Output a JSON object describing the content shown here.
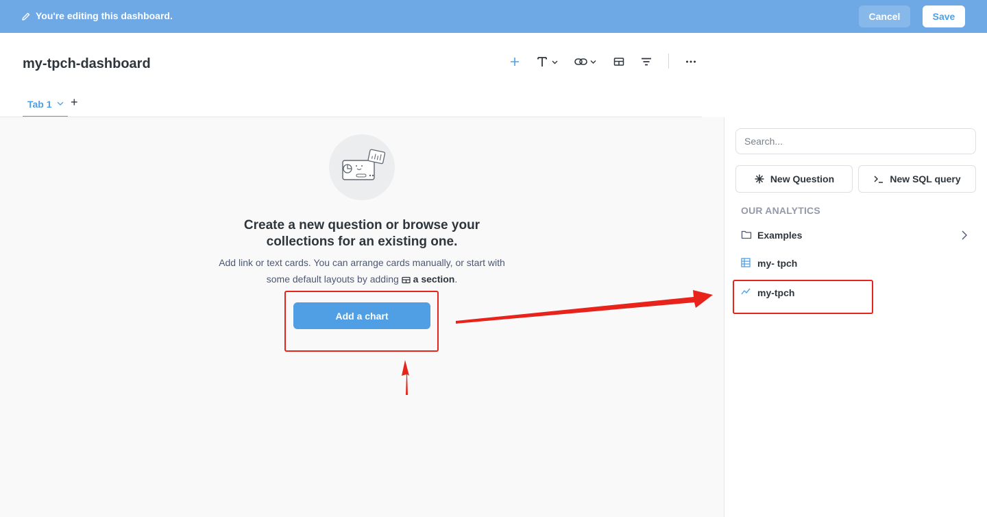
{
  "editbar": {
    "message": "You're editing this dashboard.",
    "cancel_label": "Cancel",
    "save_label": "Save"
  },
  "header": {
    "title": "my-tpch-dashboard",
    "toolbar_icons": [
      "add-card-icon",
      "text-card-icon",
      "link-card-icon",
      "section-icon",
      "filter-icon",
      "more-icon"
    ]
  },
  "tabs": {
    "items": [
      {
        "label": "Tab 1"
      }
    ],
    "add_label": "+"
  },
  "empty_state": {
    "title": "Create a new question or browse your collections for an existing one.",
    "desc_before": "Add link or text cards. You can arrange cards manually, or start with some default layouts by adding",
    "desc_link": "a section",
    "desc_after": ".",
    "button_label": "Add a chart"
  },
  "sidebar": {
    "search_placeholder": "Search...",
    "new_question_label": "New Question",
    "new_sql_label": "New SQL query",
    "section_title": "OUR ANALYTICS",
    "items": [
      {
        "label": "Examples",
        "icon": "folder-icon"
      },
      {
        "label": "my- tpch",
        "icon": "table-icon"
      },
      {
        "label": "my-tpch",
        "icon": "line-chart-icon"
      }
    ]
  },
  "colors": {
    "editbar": "#6ea9e6",
    "brand": "#509ee3",
    "annotation": "#e8231b"
  }
}
